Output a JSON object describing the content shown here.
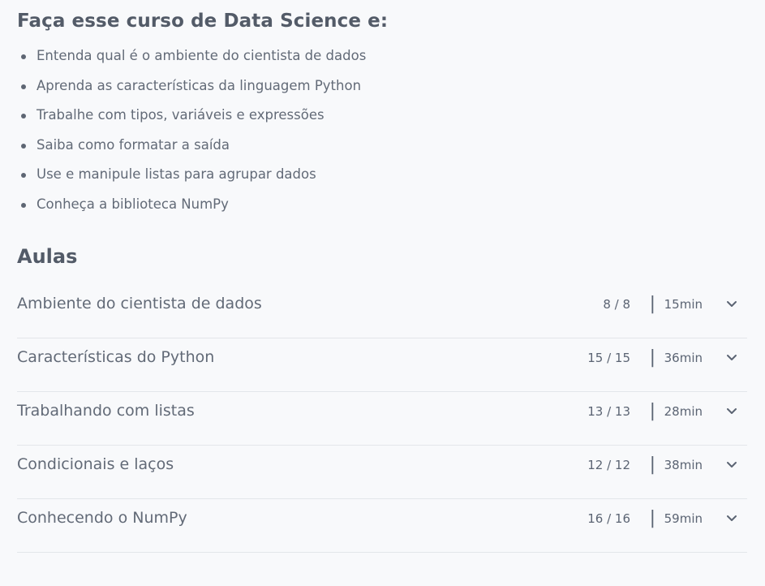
{
  "course": {
    "heading": "Faça esse curso de Data Science e:",
    "benefits": [
      "Entenda qual é o ambiente do cientista de dados",
      "Aprenda as características da linguagem Python",
      "Trabalhe com tipos, variáveis e expressões",
      "Saiba como formatar a saída",
      "Use e manipule listas para agrupar dados",
      "Conheça a biblioteca NumPy"
    ]
  },
  "aulas": {
    "title": "Aulas",
    "separator": "|",
    "lessons": [
      {
        "title": "Ambiente do cientista de dados",
        "count": "8 / 8",
        "duration": "15min",
        "icon": "chevron-down-icon"
      },
      {
        "title": "Características do Python",
        "count": "15 / 15",
        "duration": "36min",
        "icon": "chevron-down-icon"
      },
      {
        "title": "Trabalhando com listas",
        "count": "13 / 13",
        "duration": "28min",
        "icon": "chevron-down-icon"
      },
      {
        "title": "Condicionais e laços",
        "count": "12 / 12",
        "duration": "38min",
        "icon": "chevron-down-icon"
      },
      {
        "title": "Conhecendo o NumPy",
        "count": "16 / 16",
        "duration": "59min",
        "icon": "chevron-down-icon"
      }
    ]
  },
  "colors": {
    "background": "#f8f9fb",
    "text": "#5b6473",
    "divider": "#e3e6ea"
  }
}
